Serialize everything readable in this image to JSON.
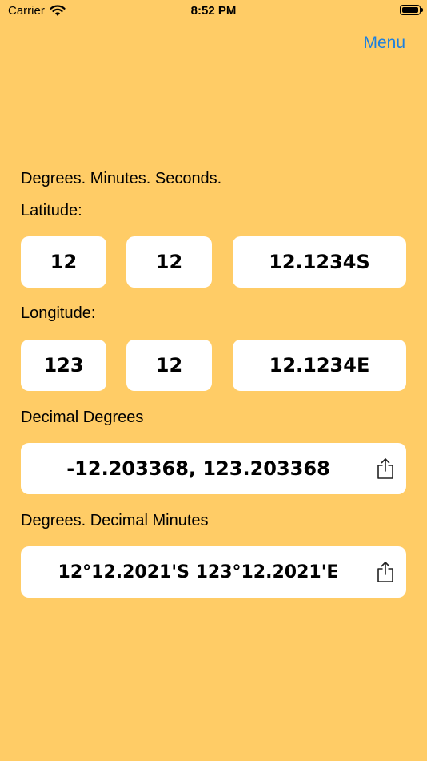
{
  "status": {
    "carrier": "Carrier",
    "time": "8:52 PM"
  },
  "nav": {
    "menu_label": "Menu"
  },
  "dms": {
    "heading": "Degrees. Minutes. Seconds.",
    "latitude_label": "Latitude:",
    "latitude": {
      "degrees": "12",
      "minutes": "12",
      "seconds": "12.1234S"
    },
    "longitude_label": "Longitude:",
    "longitude": {
      "degrees": "123",
      "minutes": "12",
      "seconds": "12.1234E"
    }
  },
  "decimal_degrees": {
    "label": "Decimal Degrees",
    "value": "-12.203368, 123.203368"
  },
  "decimal_minutes": {
    "label": "Degrees. Decimal Minutes",
    "value": "12°12.2021'S 123°12.2021'E"
  },
  "colors": {
    "background": "#FFCC66",
    "accent": "#1A7FE0"
  }
}
